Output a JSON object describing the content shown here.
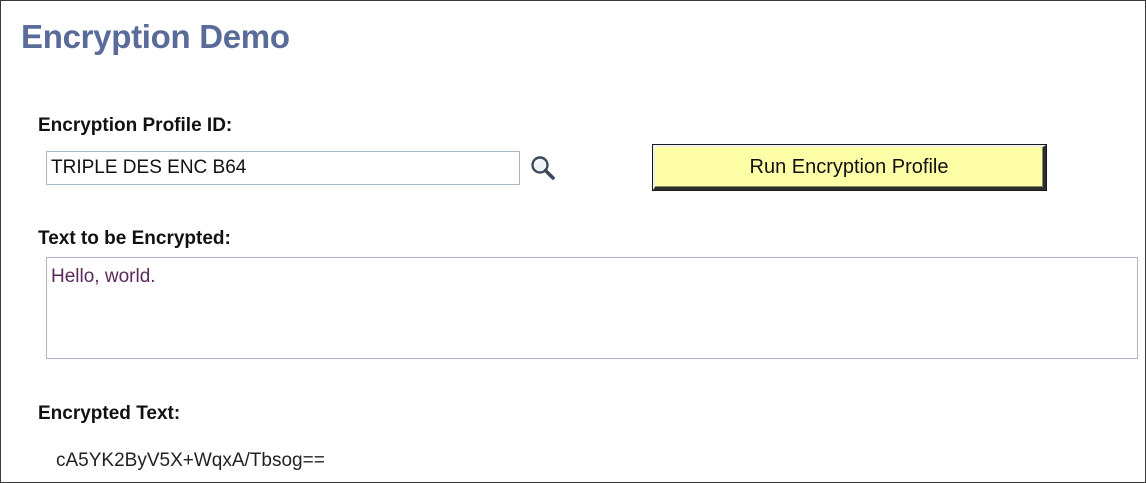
{
  "page": {
    "title": "Encryption Demo"
  },
  "profile": {
    "label": "Encryption Profile ID:",
    "value": "TRIPLE DES ENC B64",
    "lookup_icon": "magnifier-icon"
  },
  "run_button": {
    "label": "Run Encryption Profile",
    "color": "#ffffa8"
  },
  "input_text": {
    "label": "Text to be Encrypted:",
    "value": "Hello, world."
  },
  "output": {
    "label": "Encrypted Text:",
    "value": "cA5YK2ByV5X+WqxA/Tbsog=="
  },
  "colors": {
    "title": "#5a6b9a",
    "field_border": "#a9b6c6"
  }
}
